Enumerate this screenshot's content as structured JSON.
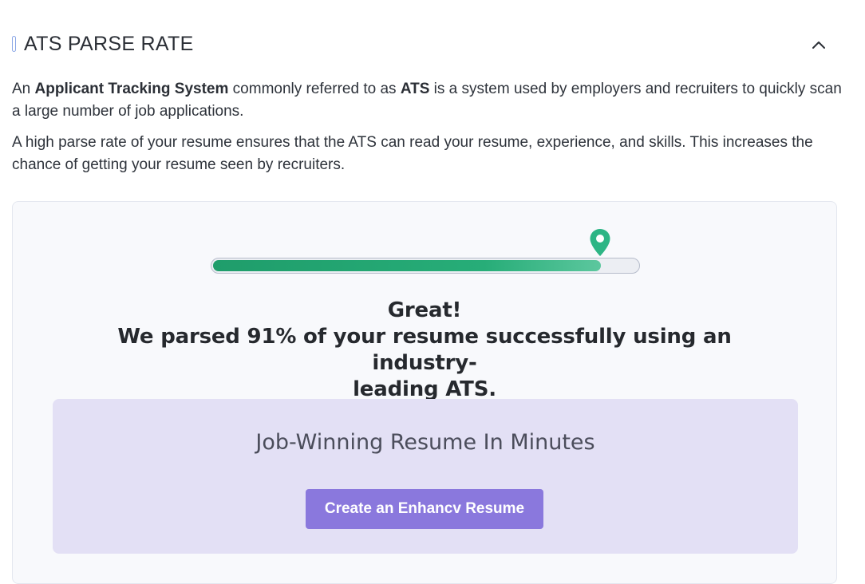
{
  "header": {
    "title": "ATS PARSE RATE",
    "collapse_icon": "chevron-up-icon"
  },
  "intro": {
    "p1_prefix": "An ",
    "p1_bold1": "Applicant Tracking System",
    "p1_mid": " commonly referred to as ",
    "p1_bold2": "ATS",
    "p1_suffix": " is a system used by employers and recruiters to quickly scan a large number of job applications.",
    "p2": "A high parse rate of your resume ensures that the ATS can read your resume, experience, and skills. This increases the chance of getting your resume seen by recruiters."
  },
  "parse_result": {
    "rate_fraction": 0.91,
    "marker_icon": "location-pin-icon",
    "headline": "Great!",
    "message_line1": "We parsed 91% of your resume successfully using an industry-",
    "message_line2": "leading ATS."
  },
  "promo": {
    "title": "Job-Winning Resume In Minutes",
    "button_label": "Create an Enhancv Resume"
  },
  "colors": {
    "progress_green": "#1f9d6b",
    "pin_green": "#2db585",
    "promo_bg": "#e3e0f5",
    "button_purple": "#8a78dd"
  }
}
